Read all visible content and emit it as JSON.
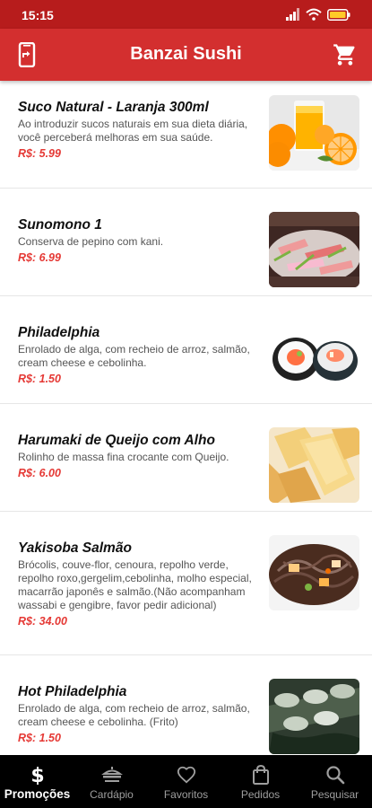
{
  "status_bar": {
    "time": "15:15",
    "icons": [
      "signal-icon",
      "wifi-icon",
      "battery-icon"
    ]
  },
  "app_bar": {
    "title": "Banzai Sushi",
    "left_icon": "phone-share-icon",
    "right_icon": "cart-icon"
  },
  "products": [
    {
      "name": "Suco Natural - Laranja 300ml",
      "description": "Ao introduzir sucos naturais em sua dieta diária, você perceberá melhoras em sua saúde.",
      "price": "R$: 5.99",
      "image": "orange-juice-image"
    },
    {
      "name": "Sunomono 1",
      "description": "Conserva de pepino com kani.",
      "price": "R$: 6.99",
      "image": "sunomono-image"
    },
    {
      "name": "Philadelphia",
      "description": "Enrolado de alga, com recheio de arroz, salmão, cream cheese e cebolinha.",
      "price": "R$: 1.50",
      "image": "philadelphia-roll-image"
    },
    {
      "name": "Harumaki de Queijo com Alho",
      "description": "Rolinho de massa fina crocante com Queijo.",
      "price": "R$: 6.00",
      "image": "harumaki-image"
    },
    {
      "name": "Yakisoba Salmão",
      "description": "Brócolis, couve-flor, cenoura, repolho verde, repolho roxo,gergelim,cebolinha, molho especial, macarrão japonês  e salmão.(Não acompanham wassabi e gengibre, favor pedir adicional)",
      "price": "R$: 34.00",
      "image": "yakisoba-image"
    },
    {
      "name": "Hot Philadelphia",
      "description": "Enrolado de alga, com recheio de arroz, salmão, cream cheese e cebolinha. (Frito)",
      "price": "R$: 1.50",
      "image": "hot-philadelphia-image"
    }
  ],
  "bottom_nav": {
    "active": "Promoções",
    "items": [
      {
        "label": "Promoções",
        "icon": "dollar-icon"
      },
      {
        "label": "Cardápio",
        "icon": "menu-tray-icon"
      },
      {
        "label": "Favoritos",
        "icon": "heart-icon"
      },
      {
        "label": "Pedidos",
        "icon": "shopping-bag-icon"
      },
      {
        "label": "Pesquisar",
        "icon": "search-icon"
      }
    ]
  },
  "colors": {
    "status_bar": "#b71c1c",
    "app_bar": "#d32f2f",
    "price": "#e53935",
    "nav_background": "#000000",
    "nav_inactive": "#9e9e9e"
  }
}
